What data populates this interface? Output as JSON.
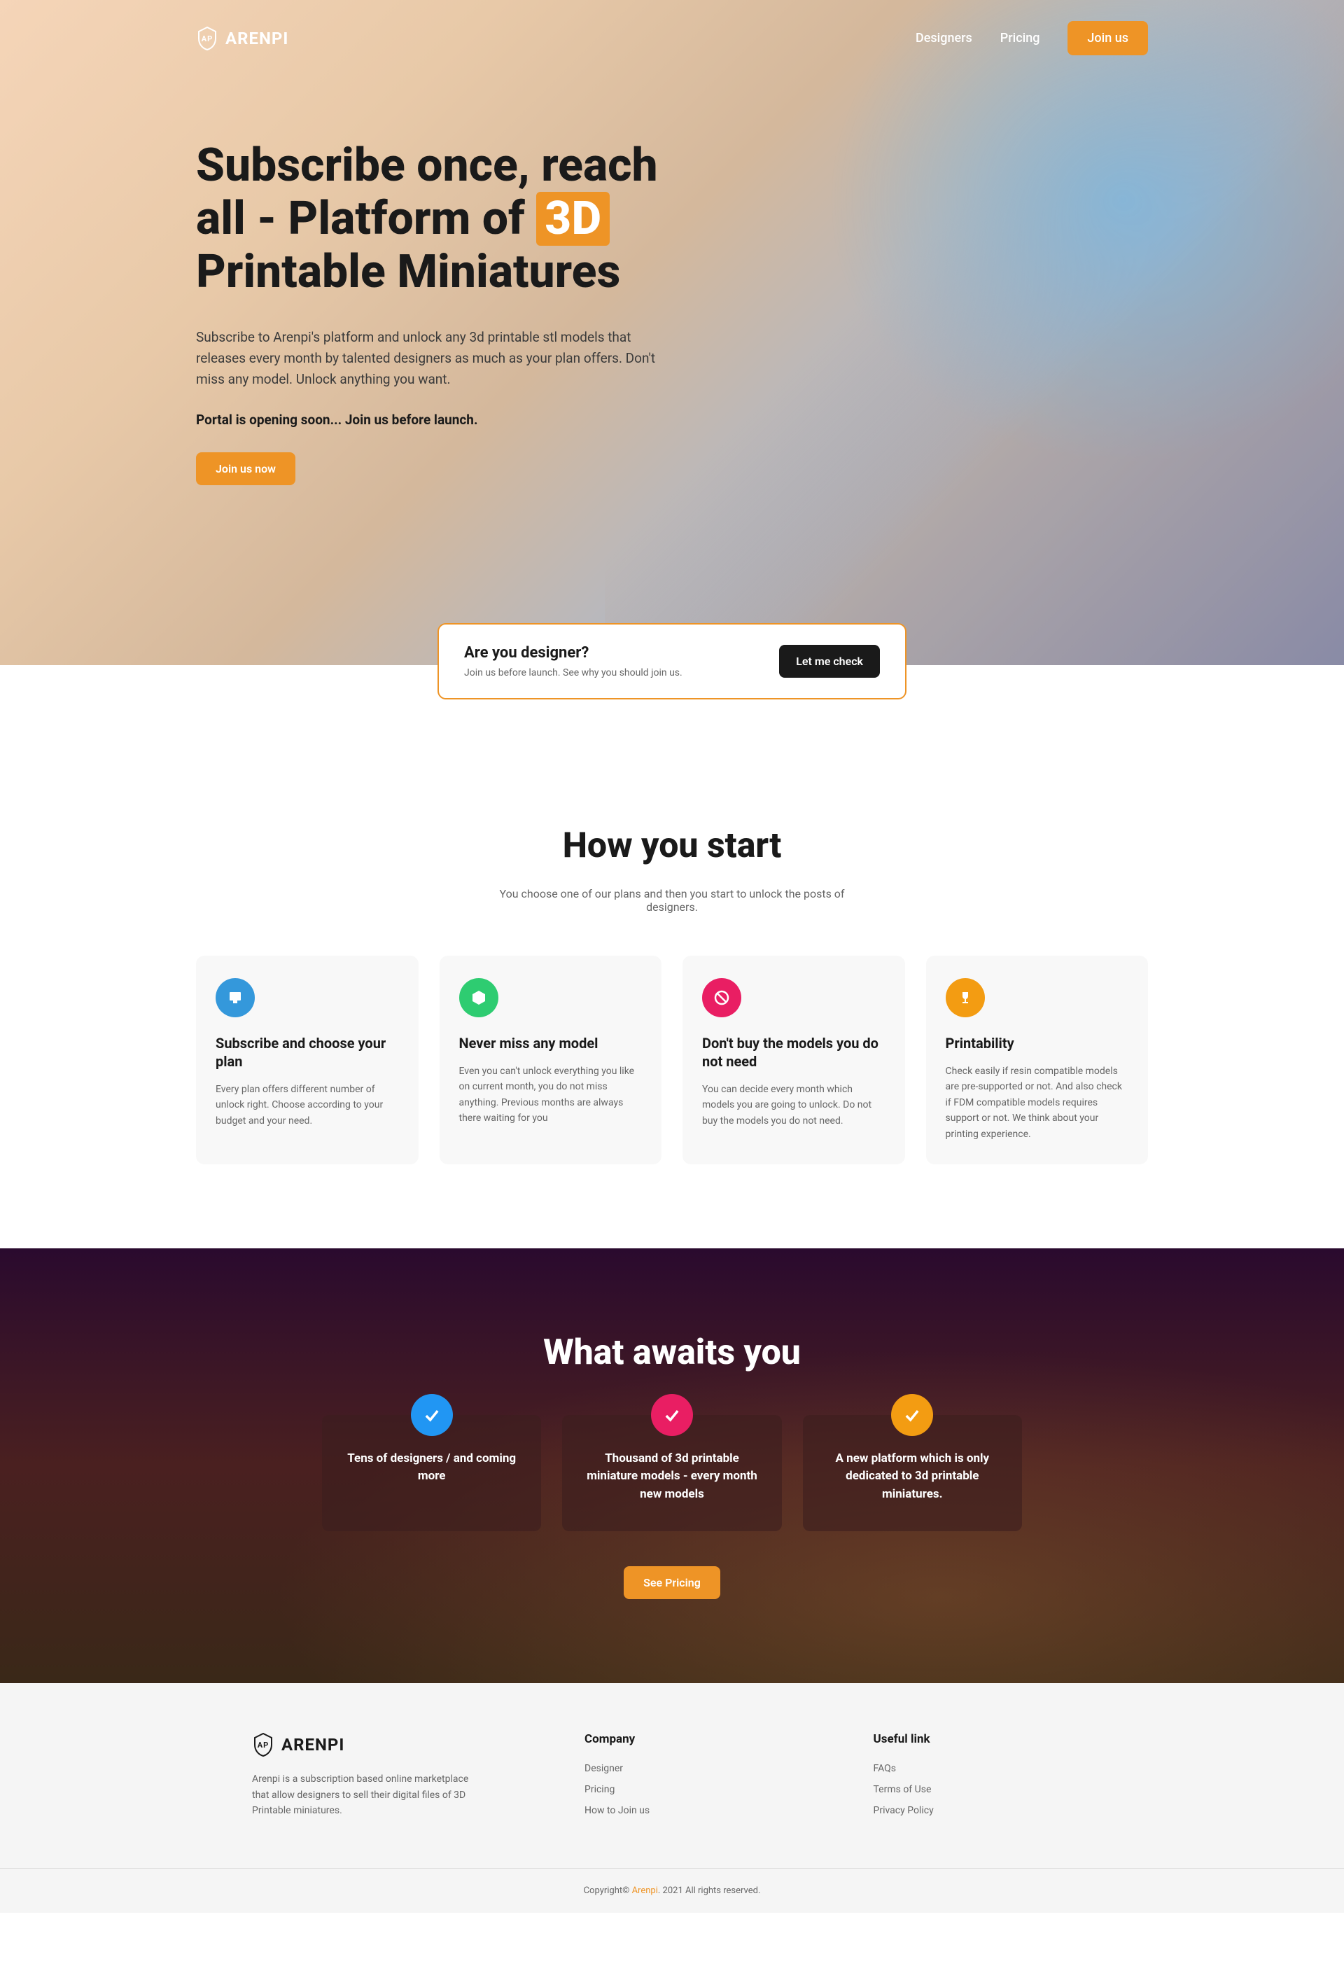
{
  "brand": "ARENPI",
  "nav": {
    "designers": "Designers",
    "pricing": "Pricing",
    "join": "Join us"
  },
  "hero": {
    "title_1": "Subscribe once, reach all - Platform of ",
    "title_highlight": "3D",
    "title_2": " Printable Miniatures",
    "desc": "Subscribe to Arenpi's platform and unlock any 3d printable stl models that releases every month by talented designers as much as your plan offers. Don't miss any model. Unlock anything you want.",
    "tagline": "Portal is opening soon... Join us before launch.",
    "cta": "Join us now"
  },
  "designer_card": {
    "title": "Are you designer?",
    "desc": "Join us before launch. See why you should join us.",
    "cta": "Let me check"
  },
  "how_start": {
    "title": "How you start",
    "sub": "You choose one of our plans and then you start to unlock the posts of designers.",
    "features": [
      {
        "title": "Subscribe and choose your plan",
        "desc": "Every plan offers different number of unlock right. Choose according to your budget and your need."
      },
      {
        "title": "Never miss any model",
        "desc": "Even you can't unlock everything you like on current month, you do not miss anything. Previous months are always there waiting for you"
      },
      {
        "title": "Don't buy the models you do not need",
        "desc": "You can decide every month which models you are going to unlock. Do not buy the models you do not need."
      },
      {
        "title": "Printability",
        "desc": "Check easily if resin compatible models are pre-supported or not. And also check if FDM compatible models requires support or not. We think about your printing experience."
      }
    ]
  },
  "awaits": {
    "title": "What awaits you",
    "cards": [
      "Tens of designers / and coming more",
      "Thousand of 3d printable miniature models - every month new models",
      "A new platform which is only dedicated to 3d printable miniatures."
    ],
    "cta": "See Pricing"
  },
  "footer": {
    "desc": "Arenpi is a subscription based online marketplace that allow designers to sell their digital files of 3D Printable miniatures.",
    "company_h": "Company",
    "company": [
      "Designer",
      "Pricing",
      "How to Join us"
    ],
    "useful_h": "Useful link",
    "useful": [
      "FAQs",
      "Terms of Use",
      "Privacy Policy"
    ],
    "copy_1": "Copyright© ",
    "copy_brand": "Arenpi",
    "copy_2": ". 2021 All rights reserved."
  }
}
